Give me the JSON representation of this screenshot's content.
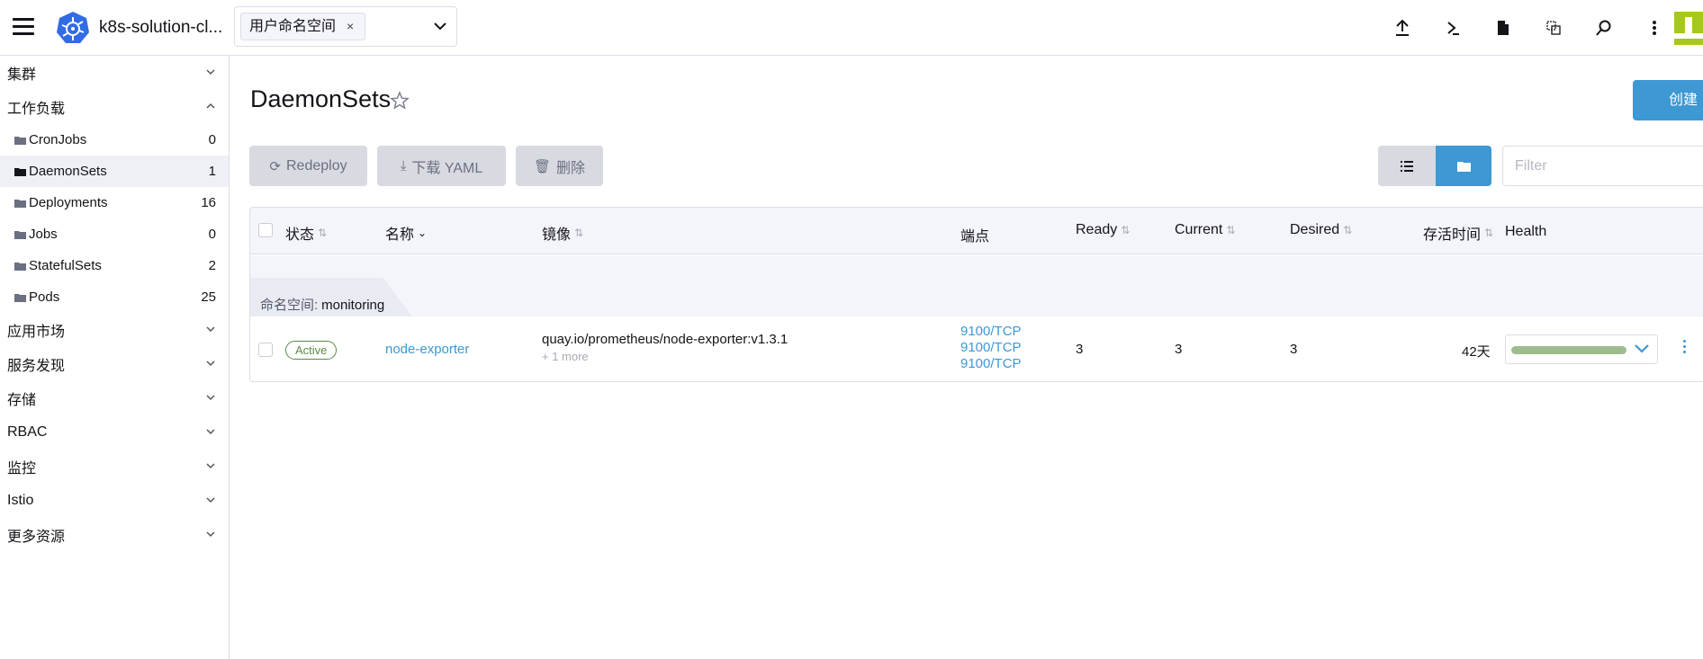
{
  "header": {
    "cluster_name": "k8s-solution-cl...",
    "namespace_chip": "用户命名空间",
    "namespace_chip_remove": "×",
    "icons": [
      "upload-icon",
      "shell-icon",
      "file-icon",
      "copy-config-icon",
      "search-icon",
      "more-vertical-icon"
    ]
  },
  "sidebar": {
    "groups": [
      {
        "label": "集群",
        "expanded": false
      },
      {
        "label": "工作负载",
        "expanded": true
      },
      {
        "label": "应用市场",
        "expanded": false
      },
      {
        "label": "服务发现",
        "expanded": false
      },
      {
        "label": "存储",
        "expanded": false
      },
      {
        "label": "RBAC",
        "expanded": false
      },
      {
        "label": "监控",
        "expanded": false
      },
      {
        "label": "Istio",
        "expanded": false
      },
      {
        "label": "更多资源",
        "expanded": false
      }
    ],
    "workload_items": [
      {
        "label": "CronJobs",
        "count": "0"
      },
      {
        "label": "DaemonSets",
        "count": "1",
        "active": true
      },
      {
        "label": "Deployments",
        "count": "16"
      },
      {
        "label": "Jobs",
        "count": "0"
      },
      {
        "label": "StatefulSets",
        "count": "2"
      },
      {
        "label": "Pods",
        "count": "25"
      }
    ]
  },
  "main": {
    "title": "DaemonSets",
    "create_label": "创建",
    "actions": {
      "redeploy": "Redeploy",
      "download_yaml": "下载 YAML",
      "delete": "删除"
    },
    "filter_placeholder": "Filter"
  },
  "table": {
    "headers": {
      "state": "状态",
      "name": "名称",
      "image": "镜像",
      "endpoints": "端点",
      "ready": "Ready",
      "current": "Current",
      "desired": "Desired",
      "age": "存活时间",
      "health": "Health"
    },
    "group": {
      "prefix": "命名空间:",
      "namespace": "monitoring"
    },
    "rows": [
      {
        "state": "Active",
        "name": "node-exporter",
        "image": "quay.io/prometheus/node-exporter:v1.3.1",
        "image_more": "+ 1 more",
        "endpoints": [
          "9100/TCP",
          "9100/TCP",
          "9100/TCP"
        ],
        "ready": "3",
        "current": "3",
        "desired": "3",
        "age": "42天",
        "health_fraction": 1.0
      }
    ]
  },
  "colors": {
    "accent": "#3d98d3",
    "active_badge": "#5a8a44",
    "health_bar": "#9ebd8f",
    "button_disabled": "#d8dae1"
  }
}
